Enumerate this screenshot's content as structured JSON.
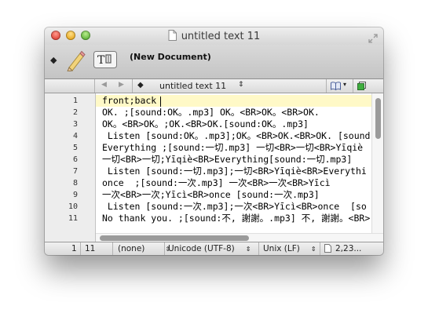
{
  "window": {
    "title": "untitled text 11"
  },
  "toolbar": {
    "bullet": "◆",
    "document_label": "(New Document)"
  },
  "navbar": {
    "back_arrow": "◀",
    "forward_arrow": "▶",
    "bullet": "◆",
    "file_name": "untitled text 11",
    "updown": "⇕",
    "caret": "▾"
  },
  "editor": {
    "line_numbers": [
      "1",
      "2",
      "3",
      "4",
      "5",
      "6",
      "7",
      "8",
      "9",
      "10",
      "11"
    ],
    "lines": [
      "front;back",
      "OK. ;[sound:OK。.mp3] OK。<BR>OK。<BR>OK.",
      "OK。<BR>OK。;OK.<BR>OK.[sound:OK。.mp3]",
      " Listen [sound:OK。.mp3];OK。<BR>OK.<BR>OK. [sound:",
      "Everything ;[sound:一切.mp3] 一切<BR>一切<BR>Yīqiè",
      "一切<BR>一切;Yīqiè<BR>Everything[sound:一切.mp3]",
      " Listen [sound:一切.mp3];一切<BR>Yīqiè<BR>Everythi",
      "once  ;[sound:一次.mp3] 一次<BR>一次<BR>Yīcì",
      "一次<BR>一次;Yīcì<BR>once [sound:一次.mp3]",
      " Listen [sound:一次.mp3];一次<BR>Yīcì<BR>once  [so",
      "No thank you. ;[sound:不, 謝謝。.mp3] 不, 謝謝。<BR>"
    ]
  },
  "status": {
    "line": "1",
    "column": "11",
    "syntax": "(none)",
    "encoding": "Unicode (UTF-8)",
    "line_endings": "Unix (LF)",
    "updown": "⇕",
    "size": "2,23..."
  },
  "colors": {
    "current_line_highlight": "#fff9c7",
    "close_button": "#e0453a",
    "minimize_button": "#e8a922",
    "zoom_button": "#5fb33a"
  }
}
